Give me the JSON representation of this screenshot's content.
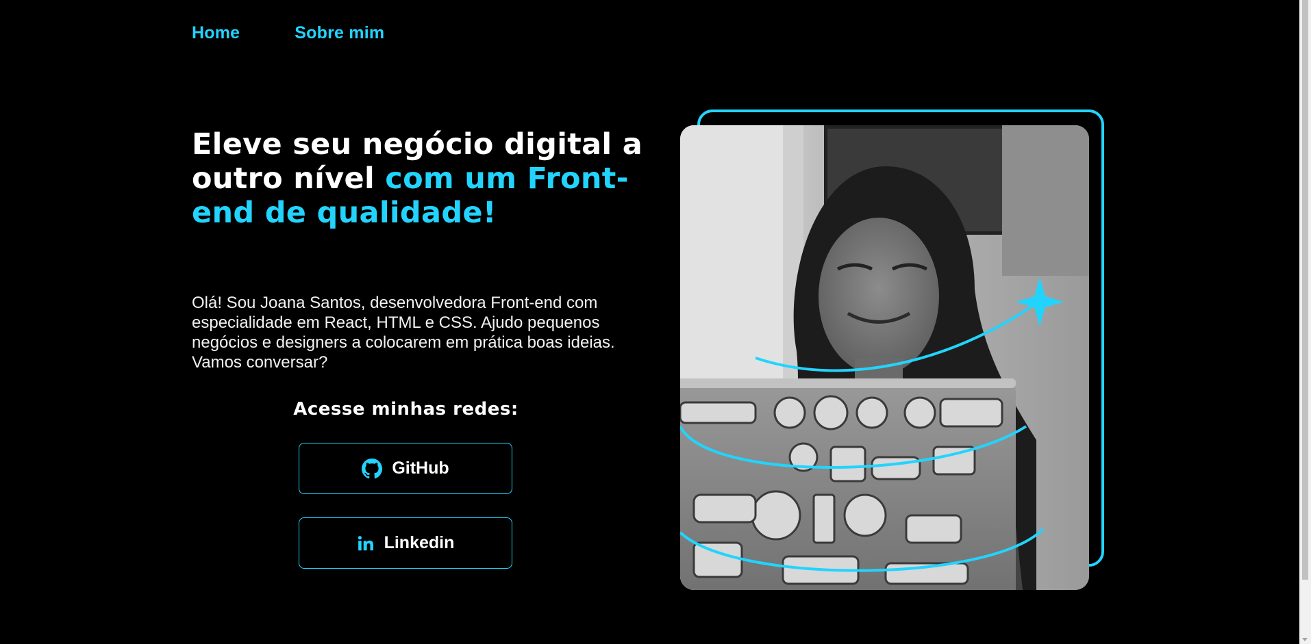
{
  "nav": {
    "items": [
      {
        "label": "Home"
      },
      {
        "label": "Sobre mim"
      }
    ]
  },
  "hero": {
    "headline_main": "Eleve seu negócio digital a outro nível ",
    "headline_accent": "com um Front-end de qualidade!",
    "intro": "Olá! Sou Joana Santos, desenvolvedora Front-end com especialidade em React, HTML e CSS. Ajudo pequenos negócios e designers a colocarem em prática boas ideias. Vamos conversar?"
  },
  "socials": {
    "title": "Acesse minhas redes:",
    "buttons": [
      {
        "label": "GitHub",
        "icon": "github-icon"
      },
      {
        "label": "Linkedin",
        "icon": "linkedin-icon"
      }
    ]
  },
  "theme": {
    "background": "#000000",
    "accent": "#22d4fd",
    "text": "#ffffff"
  }
}
